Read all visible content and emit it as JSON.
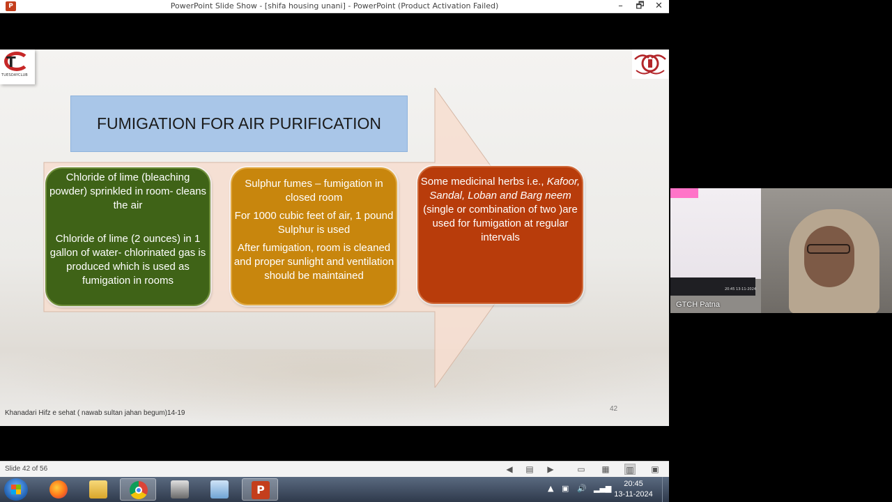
{
  "window": {
    "app_icon": "P",
    "title": "PowerPoint Slide Show - [shifa housing unani] - PowerPoint (Product Activation Failed)",
    "minimize": "–",
    "restore": "🗗",
    "close": "✕"
  },
  "slide": {
    "logo_left_caption": "TUESDAYCLUB",
    "heading": "FUMIGATION FOR AIR PURIFICATION",
    "cards": [
      {
        "color": "#3f6317",
        "paragraphs": [
          "Chloride of lime (bleaching powder) sprinkled in room- cleans the air",
          "Chloride of lime (2 ounces) in 1 gallon of water- chlorinated  gas is produced which is used as fumigation in rooms"
        ]
      },
      {
        "color": "#c8860d",
        "paragraphs": [
          "Sulphur fumes – fumigation in closed room",
          "For 1000 cubic feet of air, 1 pound Sulphur is used",
          "After fumigation, room is cleaned and proper sunlight and ventilation should be maintained"
        ]
      },
      {
        "color": "#b83c0b",
        "text_pre": "Some medicinal herbs i.e.,",
        "text_italic": "Kafoor, Sandal, Loban and Barg neem",
        "text_post": "(single or combination of two )are used for fumigation at regular intervals"
      }
    ],
    "footer_reference": "Khanadari Hifz e sehat ( nawab sultan jahan begum)14-19",
    "page_number": "42"
  },
  "statusbar": {
    "slide_info": "Slide 42 of 56",
    "icons": [
      "previous-icon",
      "slide-menu-icon",
      "next-icon",
      "normal-view-icon",
      "slide-sorter-icon",
      "reading-view-icon",
      "slideshow-icon"
    ]
  },
  "taskbar": {
    "apps": [
      "firefox-icon",
      "file-explorer-icon",
      "chrome-icon",
      "scanner-icon",
      "folder-icon",
      "powerpoint-icon"
    ],
    "tray_arrow": "▲",
    "time": "20:45",
    "date": "13-11-2024"
  },
  "video": {
    "participant_name": "GTCH Patna",
    "laptop_time": "20:45",
    "laptop_date": "13-11-2024"
  }
}
